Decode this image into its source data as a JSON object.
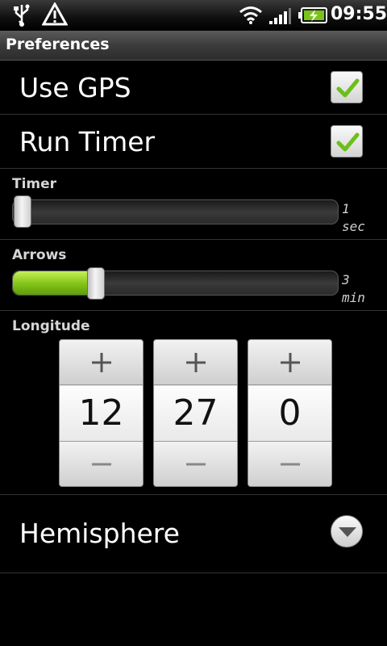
{
  "status_bar": {
    "time": "09:55",
    "icons": [
      "usb-icon",
      "warning-icon",
      "wifi-icon",
      "signal-icon",
      "battery-charging-icon"
    ]
  },
  "header": {
    "title": "Preferences"
  },
  "prefs": {
    "use_gps": {
      "label": "Use GPS",
      "checked": true
    },
    "run_timer": {
      "label": "Run Timer",
      "checked": true
    }
  },
  "sliders": {
    "timer": {
      "title": "Timer",
      "value": "1",
      "unit": "sec",
      "fraction": 0.0
    },
    "arrows": {
      "title": "Arrows",
      "value": "3",
      "unit": "min",
      "fraction": 0.24
    }
  },
  "longitude": {
    "title": "Longitude",
    "values": [
      "12",
      "27",
      "0"
    ],
    "inc_symbol": "+",
    "dec_symbol": "−"
  },
  "hemisphere": {
    "label": "Hemisphere",
    "icon": "chevron-down-icon"
  },
  "colors": {
    "accent": "#86c61a",
    "check": "#6cbf1a",
    "background": "#000000"
  }
}
